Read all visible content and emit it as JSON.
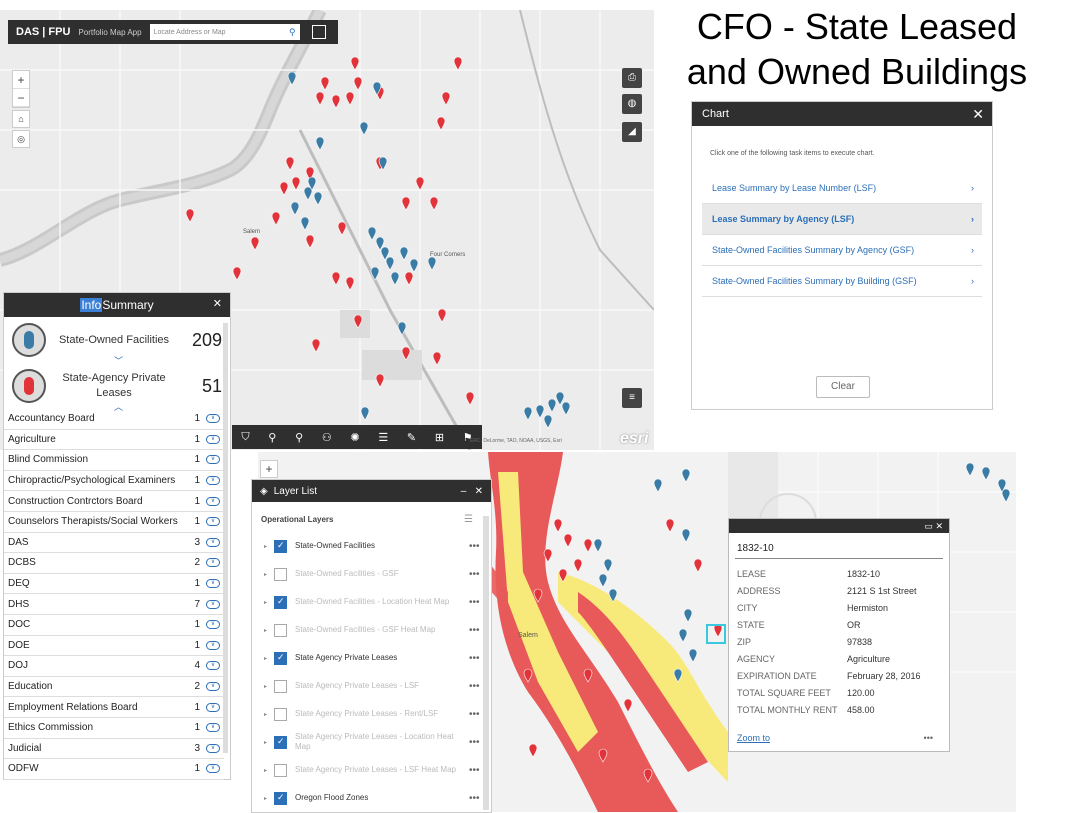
{
  "title": {
    "line1": "CFO - State Leased",
    "line2": "and Owned Buildings"
  },
  "app": {
    "logo": "DAS | FPU",
    "name": "Portfolio Map App",
    "search_placeholder": "Locate Address or Map"
  },
  "map": {
    "label_salem": "Salem",
    "label_four_corners": "Four Corners",
    "attribution": "ERC, DeLorme, TAO, NOAA, USGS, Esri",
    "esri": "esri"
  },
  "info": {
    "title_hl": "Info",
    "title_rest": " Summary",
    "owned_label": "State-Owned Facilities",
    "owned_count": "209",
    "leased_label": "State-Agency Private Leases",
    "leased_count": "51",
    "agencies": [
      {
        "name": "Accountancy Board",
        "count": "1"
      },
      {
        "name": "Agriculture",
        "count": "1"
      },
      {
        "name": "Blind Commission",
        "count": "1"
      },
      {
        "name": "Chiropractic/Psychological Examiners",
        "count": "1"
      },
      {
        "name": "Construction Contrctors Board",
        "count": "1"
      },
      {
        "name": "Counselors Therapists/Social Workers",
        "count": "1"
      },
      {
        "name": "DAS",
        "count": "3"
      },
      {
        "name": "DCBS",
        "count": "2"
      },
      {
        "name": "DEQ",
        "count": "1"
      },
      {
        "name": "DHS",
        "count": "7"
      },
      {
        "name": "DOC",
        "count": "1"
      },
      {
        "name": "DOE",
        "count": "1"
      },
      {
        "name": "DOJ",
        "count": "4"
      },
      {
        "name": "Education",
        "count": "2"
      },
      {
        "name": "Employment Relations Board",
        "count": "1"
      },
      {
        "name": "Ethics Commission",
        "count": "1"
      },
      {
        "name": "Judicial",
        "count": "3"
      },
      {
        "name": "ODFW",
        "count": "1"
      }
    ]
  },
  "chart_panel": {
    "title": "Chart",
    "instructions": "Click one of the following task items to execute chart.",
    "items": [
      "Lease Summary by Lease Number (LSF)",
      "Lease Summary by Agency (LSF)",
      "State-Owned Facilities Summary by Agency (GSF)",
      "State-Owned Facilities Summary by Building (GSF)"
    ],
    "clear_label": "Clear"
  },
  "layer_list": {
    "title": "Layer List",
    "subtitle": "Operational Layers",
    "layers": [
      {
        "name": "State-Owned Facilities",
        "checked": true,
        "dim": false
      },
      {
        "name": "State-Owned Facilities - GSF",
        "checked": false,
        "dim": true
      },
      {
        "name": "State-Owned Facilities - Location Heat Map",
        "checked": true,
        "dim": true
      },
      {
        "name": "State-Owned Facilities - GSF Heat Map",
        "checked": false,
        "dim": true
      },
      {
        "name": "State Agency Private Leases",
        "checked": true,
        "dim": false
      },
      {
        "name": "State Agency Private Leases - LSF",
        "checked": false,
        "dim": true
      },
      {
        "name": "State Agency Private Leases - Rent/LSF",
        "checked": false,
        "dim": true
      },
      {
        "name": "State Agency Private Leases - Location Heat Map",
        "checked": true,
        "dim": true
      },
      {
        "name": "State Agency Private Leases - LSF Heat Map",
        "checked": false,
        "dim": true
      },
      {
        "name": "Oregon Flood Zones",
        "checked": true,
        "dim": false
      }
    ]
  },
  "popup": {
    "title": "1832-10",
    "fields": [
      {
        "k": "LEASE",
        "v": "1832-10"
      },
      {
        "k": "ADDRESS",
        "v": "2121 S 1st Street"
      },
      {
        "k": "CITY",
        "v": "Hermiston"
      },
      {
        "k": "STATE",
        "v": "OR"
      },
      {
        "k": "ZIP",
        "v": "97838"
      },
      {
        "k": "AGENCY",
        "v": "Agriculture"
      },
      {
        "k": "EXPIRATION DATE",
        "v": "February 28, 2016"
      },
      {
        "k": "TOTAL SQUARE FEET",
        "v": "120.00"
      },
      {
        "k": "TOTAL MONTHLY RENT",
        "v": "458.00"
      }
    ],
    "zoom_label": "Zoom to",
    "more_label": "•••"
  },
  "colors": {
    "owned": "#3a7ca5",
    "leased": "#e2323a",
    "flood_red": "#e85a5a",
    "flood_yellow": "#f7ea7a",
    "header": "#2f2f2f",
    "link": "#2b6fb8"
  }
}
